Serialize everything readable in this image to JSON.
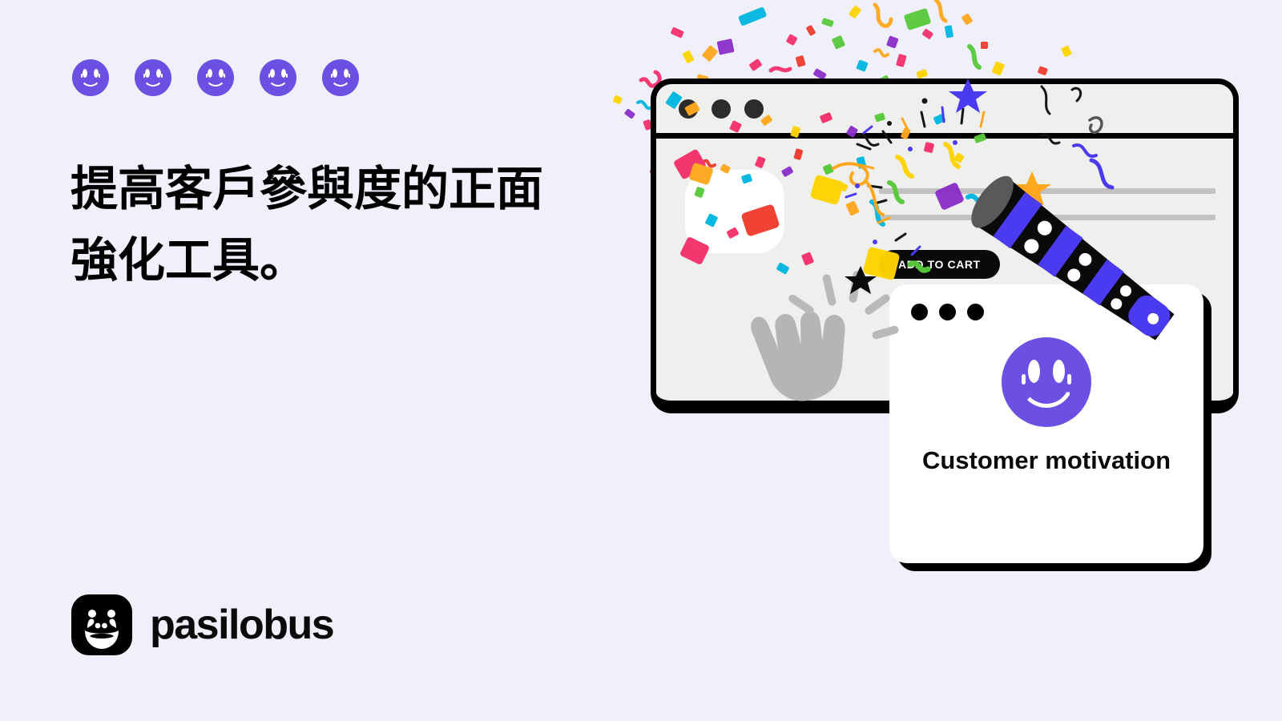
{
  "page": {
    "background_color": "#f0effc",
    "accent_purple": "#6b50e3",
    "ink": "#000000"
  },
  "hero": {
    "rating_icons": [
      {
        "name": "smiley-icon",
        "color": "#6b50e3"
      },
      {
        "name": "smiley-icon",
        "color": "#6b50e3"
      },
      {
        "name": "smiley-icon",
        "color": "#6b50e3"
      },
      {
        "name": "smiley-icon",
        "color": "#6b50e3"
      },
      {
        "name": "smiley-icon",
        "color": "#6b50e3"
      }
    ],
    "headline": "提高客戶參與度的正面強化工具。"
  },
  "brand": {
    "name": "pasilobus",
    "mark_icon": "laughing-face-icon",
    "mark_background": "#000000"
  },
  "illustration": {
    "browser": {
      "window_chrome_dots": 3,
      "product_thumbnail": "product-image-placeholder",
      "text_lines": 2,
      "cta_label": "ADD TO CART",
      "cta_background": "#0a0a0a",
      "cta_text_color": "#ffffff",
      "cursor_icon": "pointing-hand-cursor-icon"
    },
    "party_popper": {
      "icon": "party-popper-icon",
      "body_color": "#000000",
      "stripe_color": "#4b3bf0",
      "dot_color": "#ffffff"
    },
    "confetti_colors": [
      "#f5316b",
      "#00b7e0",
      "#58c93a",
      "#ffa81f",
      "#ffd400",
      "#8b2fc9",
      "#ef3b2e",
      "#ff6ea8"
    ],
    "card": {
      "window_chrome_dots": 3,
      "smiley_icon": "smiley-icon",
      "smiley_color": "#6b50e3",
      "title": "Customer motivation"
    }
  }
}
